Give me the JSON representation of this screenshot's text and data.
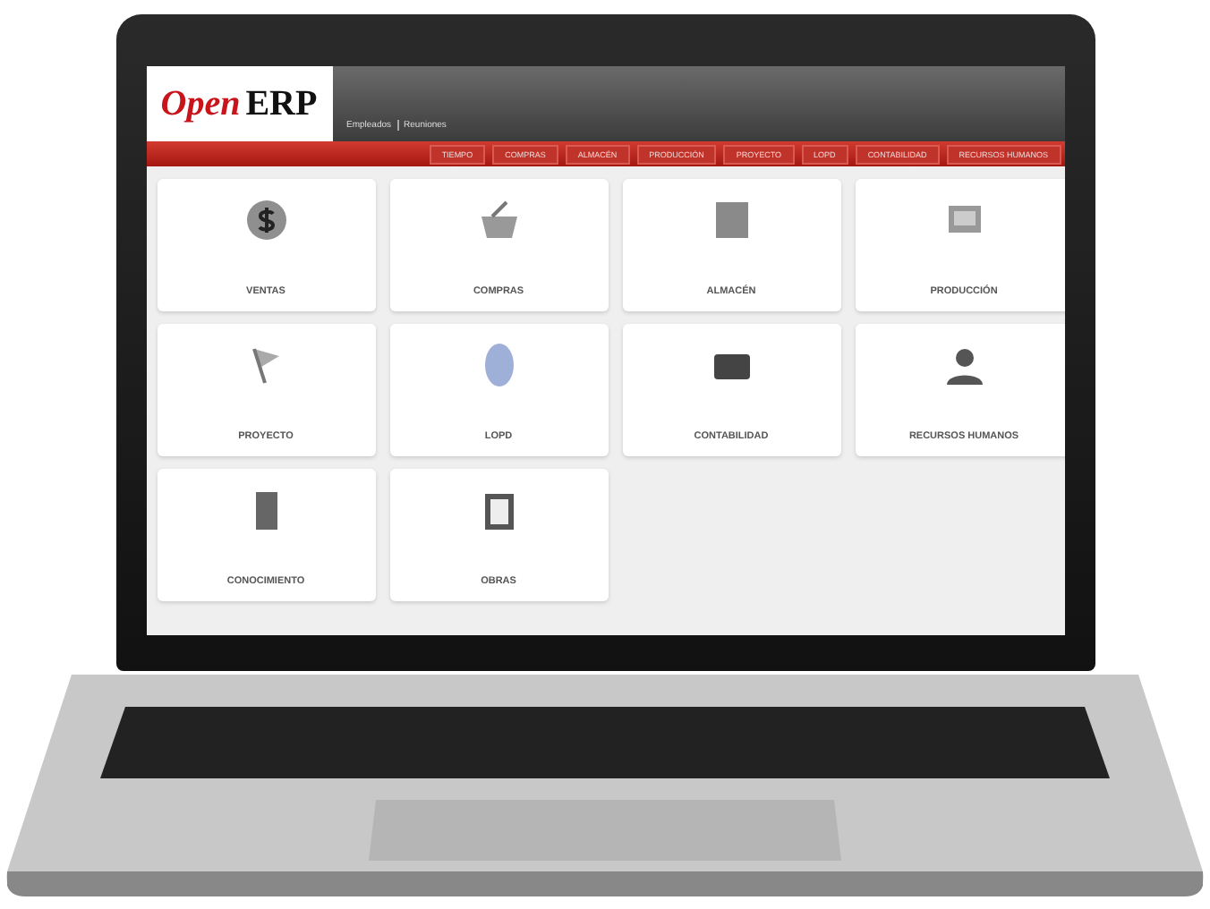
{
  "logo": {
    "first": "Open",
    "second": "ERP"
  },
  "header_links": [
    "Empleados",
    "Reuniones"
  ],
  "menu": [
    "TIEMPO",
    "COMPRAS",
    "ALMACÉN",
    "PRODUCCIÓN",
    "PROYECTO",
    "LOPD",
    "CONTABILIDAD",
    "RECURSOS HUMANOS"
  ],
  "modules": [
    "VENTAS",
    "COMPRAS",
    "ALMACÉN",
    "PRODUCCIÓN",
    "PROYECTO",
    "LOPD",
    "CONTABILIDAD",
    "RECURSOS HUMANOS",
    "CONOCIMIENTO",
    "OBRAS"
  ]
}
